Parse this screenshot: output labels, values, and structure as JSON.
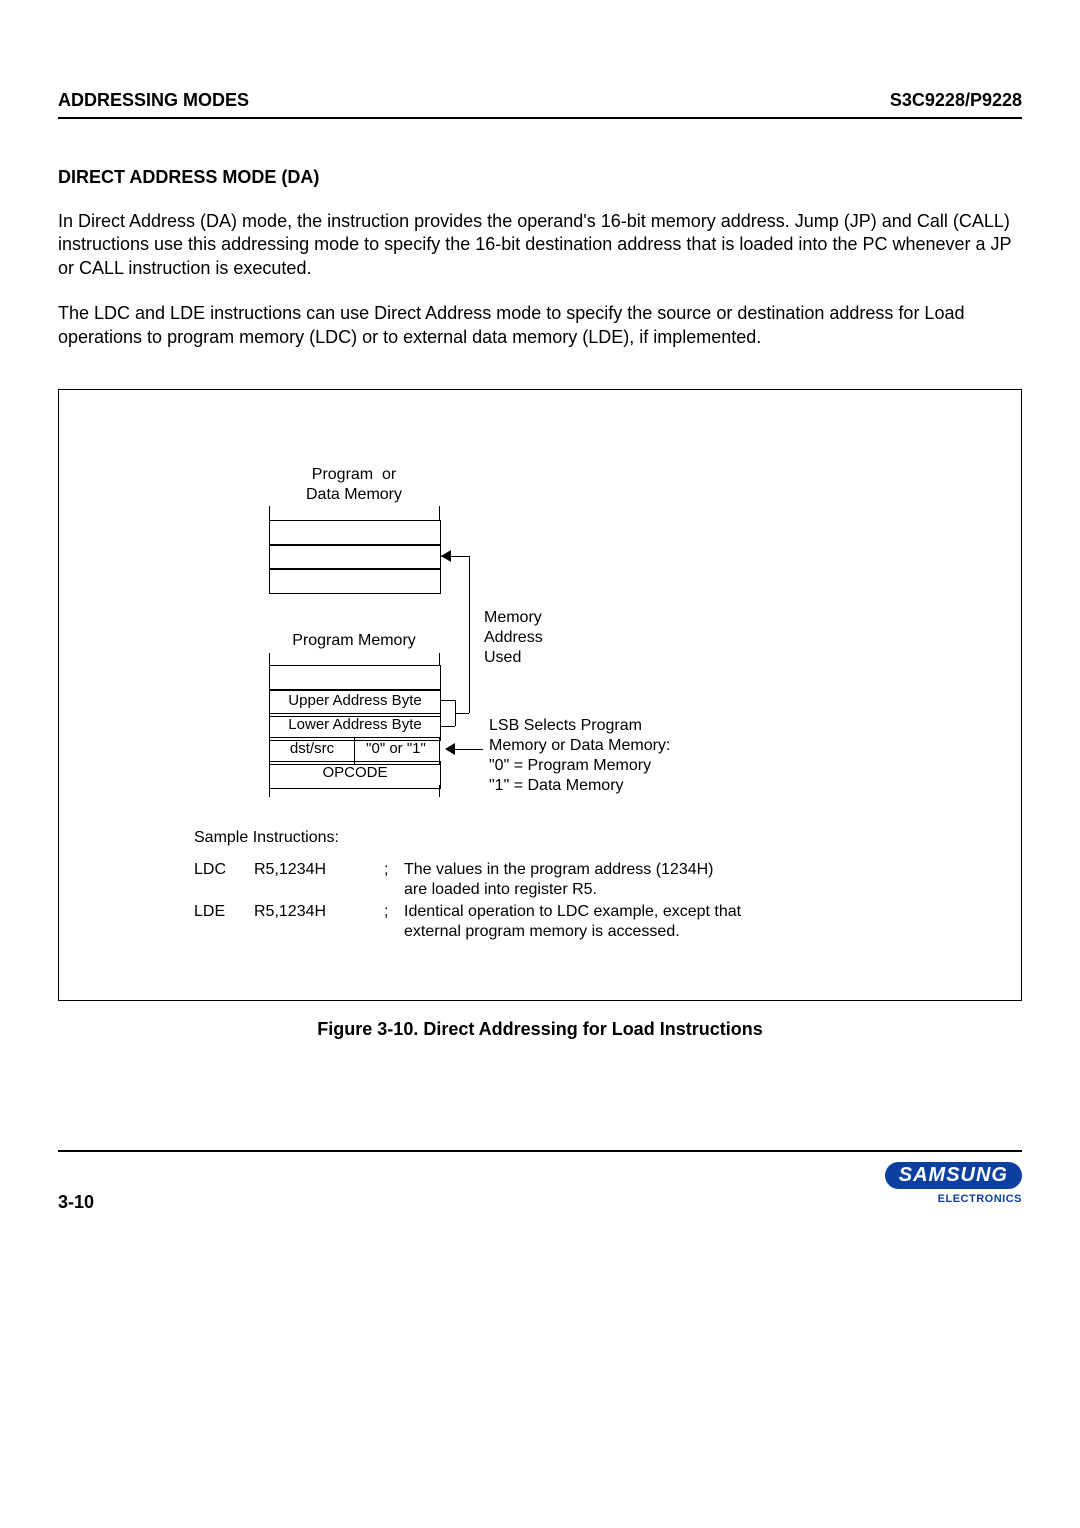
{
  "header": {
    "left": "ADDRESSING MODES",
    "right": "S3C9228/P9228"
  },
  "section_title": "DIRECT ADDRESS MODE (DA)",
  "para1": "In Direct Address (DA) mode, the instruction provides the operand's 16-bit memory address. Jump (JP) and Call (CALL) instructions use this addressing mode to specify the 16-bit destination address that is loaded into the PC whenever a JP or CALL instruction is executed.",
  "para2": "The LDC and LDE instructions can use Direct Address mode to specify the source or destination address for Load operations to program memory (LDC) or to external data memory (LDE), if implemented.",
  "diagram": {
    "prog_or_data": "Program  or\nData Memory",
    "program_memory": "Program Memory",
    "upper_addr": "Upper Address Byte",
    "lower_addr": "Lower Address Byte",
    "dst_src": "dst/src",
    "zero_one": "\"0\" or \"1\"",
    "opcode": "OPCODE",
    "mem_addr_used": "Memory\nAddress\nUsed",
    "lsb_text": "LSB Selects Program\nMemory or Data Memory:\n\"0\" = Program Memory\n\"1\" = Data Memory",
    "sample_header": "Sample Instructions:",
    "sample1_mn": "LDC",
    "sample1_op": "R5,1234H",
    "sample1_c1": ";",
    "sample1_txt": "The values in the program address (1234H)\nare loaded into register R5.",
    "sample2_mn": "LDE",
    "sample2_op": "R5,1234H",
    "sample2_c1": ";",
    "sample2_txt": "Identical operation to LDC example, except that\nexternal program memory is accessed."
  },
  "figure_caption": "Figure 3-10. Direct Addressing for Load Instructions",
  "footer": {
    "page": "3-10",
    "logo": "SAMSUNG",
    "logo_sub": "ELECTRONICS"
  }
}
